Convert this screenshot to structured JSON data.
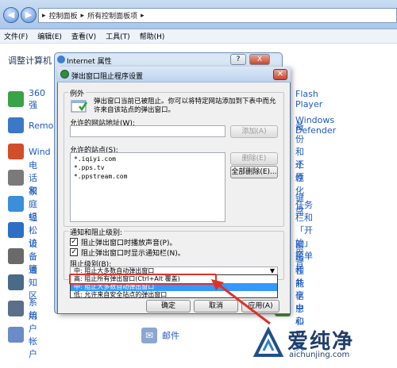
{
  "explorer": {
    "breadcrumb": [
      "控制面板",
      "所有控制面板项"
    ],
    "menu": [
      "文件(F)",
      "编辑(E)",
      "查看(V)",
      "工具(T)",
      "帮助(H)"
    ],
    "heading": "调整计算机",
    "left_items": [
      {
        "label": "360强",
        "icon": "shield-icon",
        "color": "#3aa34a"
      },
      {
        "label": "Remo",
        "icon": "remote-icon",
        "color": "#3c78c8"
      },
      {
        "label": "Wind",
        "icon": "windows-icon",
        "color": "#d24d2b"
      },
      {
        "label": "电话和",
        "icon": "phone-icon",
        "color": "#7a7a7a"
      },
      {
        "label": "家庭组",
        "icon": "homegroup-icon",
        "color": "#3a8fd8"
      },
      {
        "label": "轻松访",
        "icon": "accessibility-icon",
        "color": "#2d6fc4"
      },
      {
        "label": "设备管",
        "icon": "device-manager-icon",
        "color": "#6a6a6a"
      },
      {
        "label": "通知区",
        "icon": "notification-area-icon",
        "color": "#4a6a8a"
      },
      {
        "label": "系统",
        "icon": "system-icon",
        "color": "#5a6f8a"
      },
      {
        "label": "用户帐户",
        "icon": "user-accounts-icon",
        "color": "#6b8cc9"
      }
    ],
    "right_items": [
      {
        "label": "Flash Player",
        "icon": "flash-icon",
        "color": "#c0272d"
      },
      {
        "label": "Windows Defender",
        "icon": "defender-icon",
        "color": "#4d7fbf"
      },
      {
        "label": "备份和还原",
        "icon": "backup-icon",
        "color": "#3b9a47"
      },
      {
        "label": "个性化",
        "icon": "personalization-icon",
        "color": "#4b8fd6"
      },
      {
        "label": "键盘",
        "icon": "keyboard-icon",
        "color": "#7a7a7a"
      },
      {
        "label": "任务栏和「开始」菜单",
        "icon": "taskbar-icon",
        "color": "#4a74a8"
      },
      {
        "label": "声音",
        "icon": "sound-icon",
        "color": "#8a8a8a"
      },
      {
        "label": "网络和共享中心",
        "icon": "network-icon",
        "color": "#3e6fb0"
      },
      {
        "label": "性能信息和工具",
        "icon": "performance-icon",
        "color": "#5a8a3a"
      }
    ],
    "mail_label": "邮件"
  },
  "ie_window": {
    "title": "Internet 属性",
    "help": "?",
    "close": "X"
  },
  "popup_dialog": {
    "title": "弹出窗口阻止程序设置",
    "close": "✕",
    "exceptions_group": "例外",
    "exceptions_text": "弹出窗口当前已被阻止。你可以将特定网站添加到下表中而允许来自该站点的弹出窗口。",
    "address_label": "允许的网站地址(W):",
    "address_value": "",
    "add_button": "添加(A)",
    "allowed_label": "允许的站点(S):",
    "allowed_sites": [
      "*.iqiyi.com",
      "*.pps.tv",
      "*.ppstream.com"
    ],
    "delete_button": "删除(E)",
    "delete_all_button": "全部删除(E)...",
    "notify_group": "通知和阻止级别:",
    "checkbox1": "阻止弹出窗口时播放声音(P)。",
    "checkbox2": "阻止弹出窗口时显示通知栏(N)。",
    "level_label": "阻止级别(B):",
    "level_selected": "中: 阻止大多数自动弹出窗口",
    "level_options": [
      "高: 阻止所有弹出窗口(Ctrl+Alt 覆盖)",
      "中: 阻止大多数自动弹出窗口",
      "低: 允许来自安全站点的弹出窗口"
    ],
    "confirm_button": "确定",
    "cancel_button": "取消",
    "apply_button": "应用(A)"
  },
  "watermark": {
    "brand": "爱纯净",
    "url": "aichunjing.com"
  },
  "colors": {
    "highlight": "#3399ff",
    "annotation_red": "#e0302a",
    "link_blue": "#1e5bbf"
  }
}
